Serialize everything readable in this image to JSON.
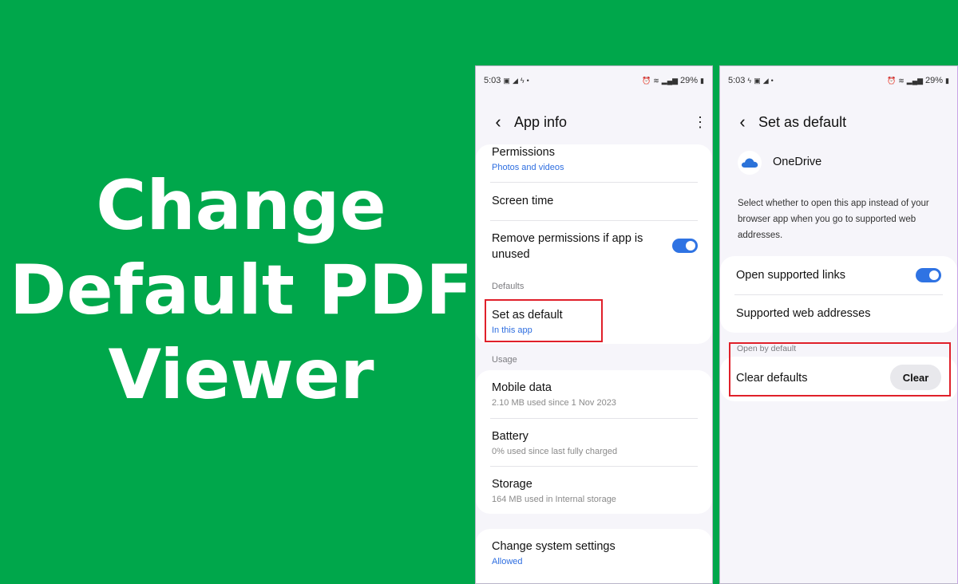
{
  "headline": {
    "line1": "Change",
    "line2": "Default PDF",
    "line3": "Viewer"
  },
  "colors": {
    "background": "#00a74b",
    "accent": "#2f73e3",
    "highlight": "#e0202a"
  },
  "status_bar": {
    "time": "5:03",
    "battery": "29%"
  },
  "app_info": {
    "title": "App info",
    "permissions": {
      "title": "Permissions",
      "sub": "Photos and videos"
    },
    "screen_time": {
      "title": "Screen time"
    },
    "remove_permissions": {
      "title": "Remove permissions if app is unused",
      "enabled": true
    },
    "defaults_label": "Defaults",
    "set_as_default": {
      "title": "Set as default",
      "sub": "In this app"
    },
    "usage_label": "Usage",
    "mobile_data": {
      "title": "Mobile data",
      "sub": "2.10 MB used since 1 Nov 2023"
    },
    "battery": {
      "title": "Battery",
      "sub": "0% used since last fully charged"
    },
    "storage": {
      "title": "Storage",
      "sub": "164 MB used in Internal storage"
    },
    "change_system": {
      "title": "Change system settings",
      "sub": "Allowed"
    }
  },
  "set_default": {
    "title": "Set as default",
    "app_name": "OneDrive",
    "description": "Select whether to open this app instead of your browser app when you go to supported web addresses.",
    "open_links": {
      "title": "Open supported links",
      "enabled": true
    },
    "web_addresses": {
      "title": "Supported web addresses"
    },
    "open_by_default_label": "Open by default",
    "clear_defaults": {
      "title": "Clear defaults",
      "button": "Clear"
    }
  }
}
